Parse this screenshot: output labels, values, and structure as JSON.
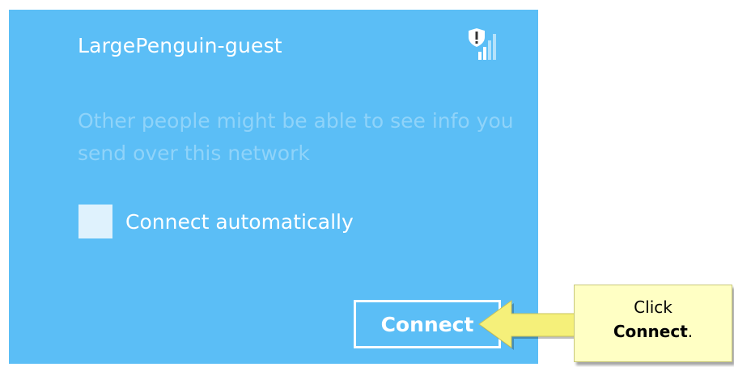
{
  "network": {
    "name": "LargePenguin-guest",
    "signal_icon": "wifi-signal-warning-icon",
    "warning_text": "Other people might be able to see info you send over this network"
  },
  "connect_automatically": {
    "label": "Connect automatically",
    "checked": false
  },
  "connect_button": {
    "label": "Connect"
  },
  "callout": {
    "line1": "Click",
    "line2_bold": "Connect",
    "line2_suffix": "."
  },
  "colors": {
    "panel": "#5bbef6",
    "callout_fill": "#ffffc4",
    "arrow": "#f5f07a"
  }
}
